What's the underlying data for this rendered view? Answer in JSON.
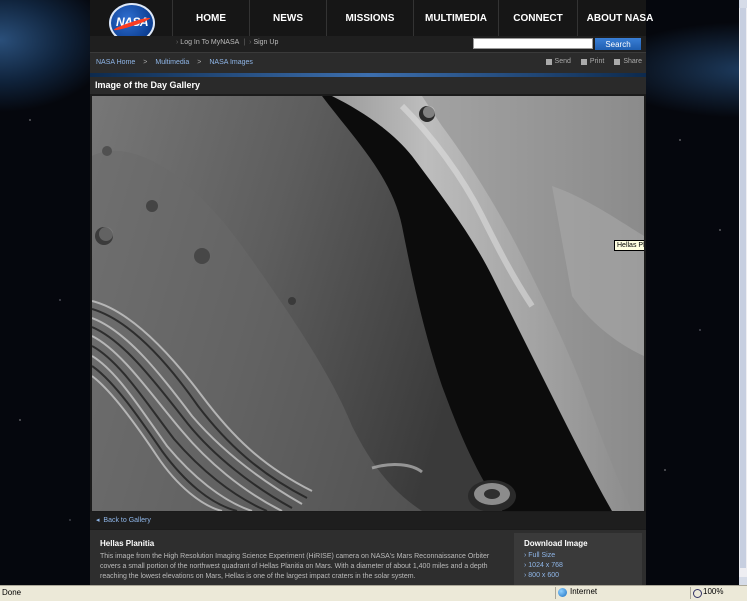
{
  "header": {
    "logo_text": "NASA",
    "nav": [
      "HOME",
      "NEWS",
      "MISSIONS",
      "MULTIMEDIA",
      "CONNECT",
      "ABOUT NASA"
    ],
    "login": "Log In To MyNASA",
    "signup": "Sign Up",
    "search_placeholder": "",
    "search_label": "Search"
  },
  "breadcrumb": {
    "items": [
      "NASA Home",
      "Multimedia",
      "NASA Images"
    ],
    "separator": ">"
  },
  "tools": {
    "send": "Send",
    "print": "Print",
    "share": "Share"
  },
  "gallery": {
    "title": "Image of the Day Gallery",
    "tooltip": "Hellas Planitia",
    "back": "Back to Gallery"
  },
  "caption": {
    "title": "Hellas Planitia",
    "text": "This image from the High Resolution Imaging Science Experiment (HiRISE) camera on NASA's Mars Reconnaissance Orbiter covers a small portion of the northwest quadrant of Hellas Planitia on Mars. With a diameter of about 1,400 miles and a depth reaching the lowest elevations on Mars, Hellas is one of the largest impact craters in the solar system."
  },
  "download": {
    "title": "Download Image",
    "links": [
      "Full Size",
      "1024 x 768",
      "800 x 600"
    ]
  },
  "statusbar": {
    "status": "Done",
    "zone": "Internet",
    "zoom": "100%"
  },
  "colors": {
    "accent_blue": "#1f5eb0",
    "link": "#8fb6e8",
    "nasa_red": "#fc3d21"
  }
}
